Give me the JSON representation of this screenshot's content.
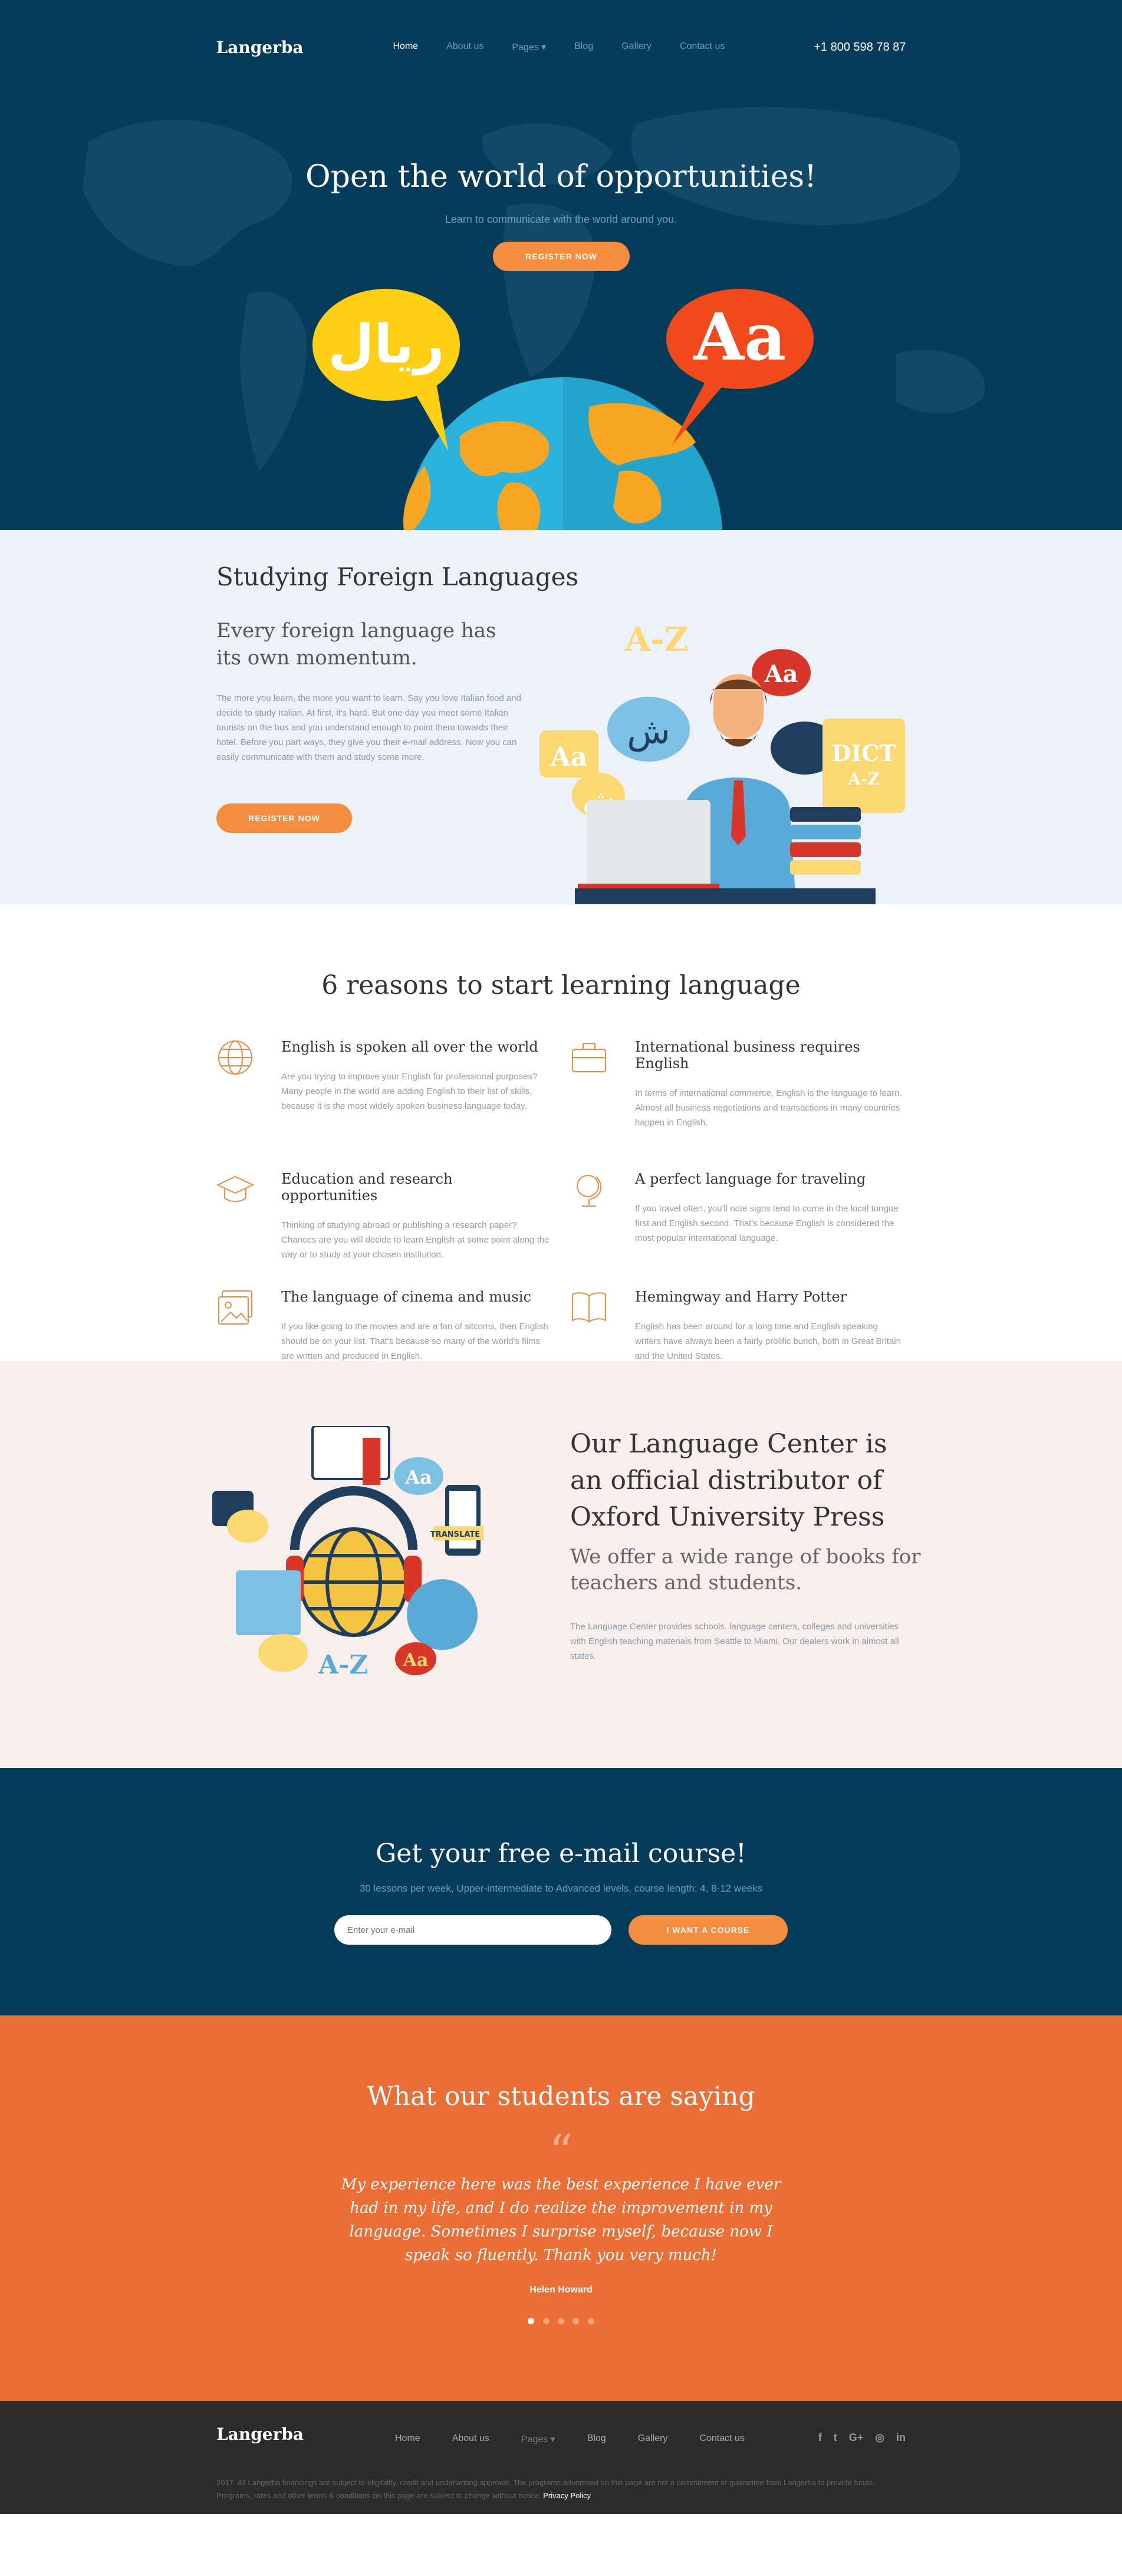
{
  "brand": {
    "name": "Langerba"
  },
  "nav": {
    "items": [
      {
        "label": "Home",
        "active": true
      },
      {
        "label": "About us"
      },
      {
        "label": "Pages ▾"
      },
      {
        "label": "Blog"
      },
      {
        "label": "Gallery"
      },
      {
        "label": "Contact us"
      }
    ],
    "phone": "+1 800 598 78 87"
  },
  "hero": {
    "title": "Open the world of opportunities!",
    "subtitle": "Learn to communicate with the world around you.",
    "button": "Register now",
    "bubble_left": "ريال",
    "bubble_right": "Aa"
  },
  "study": {
    "title": "Studying Foreign Languages",
    "subtitle": "Every foreign language has its own momentum.",
    "text": "The more you learn, the more you want to learn. Say you love Italian food and decide to study Italian. At first, it's hard. But one day you meet some Italian tourists on the bus and you understand enough to point them towards their hotel. Before you part ways, they give you their e-mail address. Now you can easily communicate with them and study some more.",
    "button": "Register now",
    "art_labels": {
      "az": "A-Z",
      "aa": "Aa",
      "sh": "ش",
      "dict": "DICT",
      "dict_az": "A-Z"
    }
  },
  "reasons": {
    "title": "6 reasons to start learning language",
    "items": [
      {
        "icon": "globe-icon",
        "title": "English is spoken all over the world",
        "text": "Are you trying to improve your English for professional purposes? Many people in the world are adding English to their list of skills, because it is the most widely spoken business language today."
      },
      {
        "icon": "briefcase-icon",
        "title": "International business requires English",
        "text": "In terms of international commerce, English is the language to learn. Almost all business negotiations and transactions in many countries happen in English."
      },
      {
        "icon": "graduation-cap-icon",
        "title": "Education and research opportunities",
        "text": "Thinking of studying abroad or publishing a research paper? Chances are you will decide to learn English at some point along the way or to study at your chosen institution."
      },
      {
        "icon": "desk-globe-icon",
        "title": "A perfect language for traveling",
        "text": "If you travel often, you'll note signs tend to come in the local tongue first and English second. That's because English is considered the most popular international language."
      },
      {
        "icon": "picture-icon",
        "title": "The language of cinema and music",
        "text": "If you like going to the movies and are a fan of sitcoms, then English should be on your list. That's because so many of the world's films are written and produced in English."
      },
      {
        "icon": "open-book-icon",
        "title": "Hemingway and Harry Potter",
        "text": "English has been around for a long time and English speaking writers have always been a fairly prolific bunch, both in Great Britain and the United States."
      }
    ]
  },
  "oxford": {
    "title": "Our Language Center is an official distributor of Oxford University Press",
    "subtitle": "We offer a wide range of books for teachers and students.",
    "text": "The Language Center provides schools, language centers, colleges and universities with English teaching materials from Seattle to Miami. Our dealers work in almost all states.",
    "art_labels": {
      "translate": "TRANSLATE",
      "aa": "Aa",
      "az": "A-Z"
    }
  },
  "email_course": {
    "title": "Get your free e-mail course!",
    "subtitle": "30 lessons per week, Upper-intermediate to Advanced levels, course length: 4, 8-12 weeks",
    "placeholder": "Enter your e-mail",
    "button": "I want a course"
  },
  "testimonials": {
    "title": "What our students are saying",
    "quote_mark": "“",
    "quote": "My experience here was the best experience I have ever had in my life, and I do realize the improvement in my language. Sometimes I surprise myself, because now I speak so fluently. Thank you very much!",
    "author": "Helen Howard",
    "dots": 5,
    "active_dot": 0
  },
  "footer": {
    "logo": "Langerba",
    "menu": [
      "Home",
      "About us",
      "Pages ▾",
      "Blog",
      "Gallery",
      "Contact us"
    ],
    "social": [
      "f",
      "t",
      "G+",
      "◎",
      "in"
    ],
    "legal": "2017. All Langerba financings are subject to eligibility, credit and underwriting approval. The programs advertised on this page are not a commitment or guarantee from Langerba to provide funds. Programs, rates and other terms & conditions on this page are subject to change without notice.",
    "privacy": "Privacy Policy"
  },
  "colors": {
    "navy": "#073b5a",
    "orange": "#f58d41",
    "coral": "#ea6e36",
    "light_blue": "#ecf2f7",
    "pink": "#f8efec",
    "footer": "#2b2b2b"
  }
}
